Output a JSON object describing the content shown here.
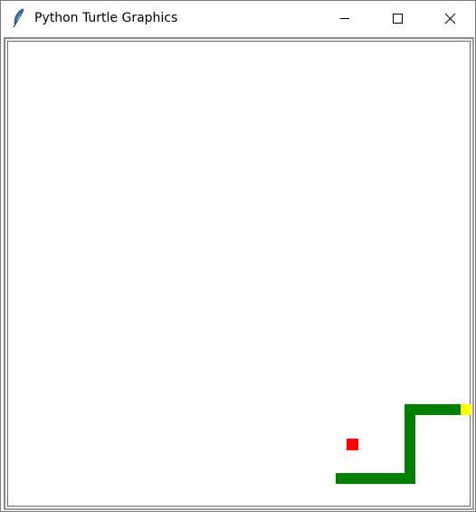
{
  "window": {
    "title": "Python Turtle Graphics",
    "app_icon": "feather-icon",
    "controls": {
      "minimize_icon": "minimize-icon",
      "maximize_icon": "maximize-icon",
      "close_icon": "close-icon"
    }
  },
  "game": {
    "colors": {
      "background": "#ffffff",
      "snake_body": "#008000",
      "snake_head": "#ffff00",
      "food": "#ff0000"
    },
    "snake_length_segments": 13,
    "food_count": 1
  }
}
